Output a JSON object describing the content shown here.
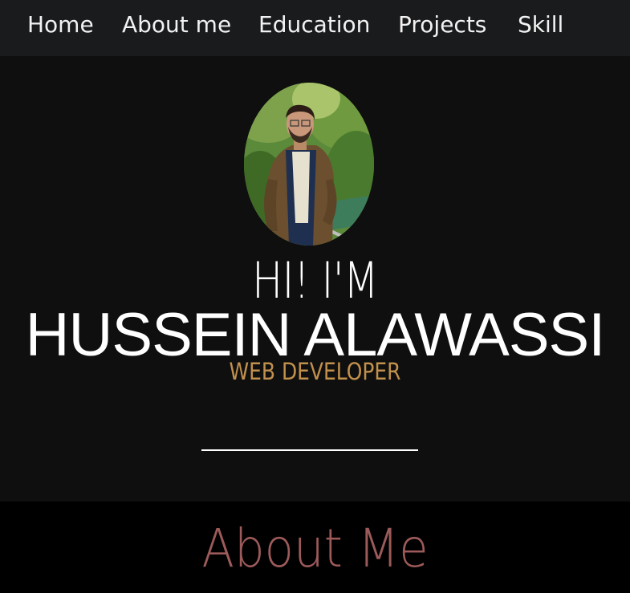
{
  "nav": {
    "items": [
      {
        "label": "Home"
      },
      {
        "label": "About me"
      },
      {
        "label": "Education"
      },
      {
        "label": "Projects"
      },
      {
        "label": "Skill"
      }
    ]
  },
  "hero": {
    "greeting": "HI! I'M",
    "name": "HUSSEIN ALAWASSI",
    "role": "WEB DEVELOPER",
    "avatar_alt": "profile-photo"
  },
  "about": {
    "title": "About Me"
  },
  "colors": {
    "nav_bg": "#1a1b1d",
    "hero_bg": "#0f0f0f",
    "role_accent": "#c1904c",
    "about_title": "#9c5a5a"
  }
}
